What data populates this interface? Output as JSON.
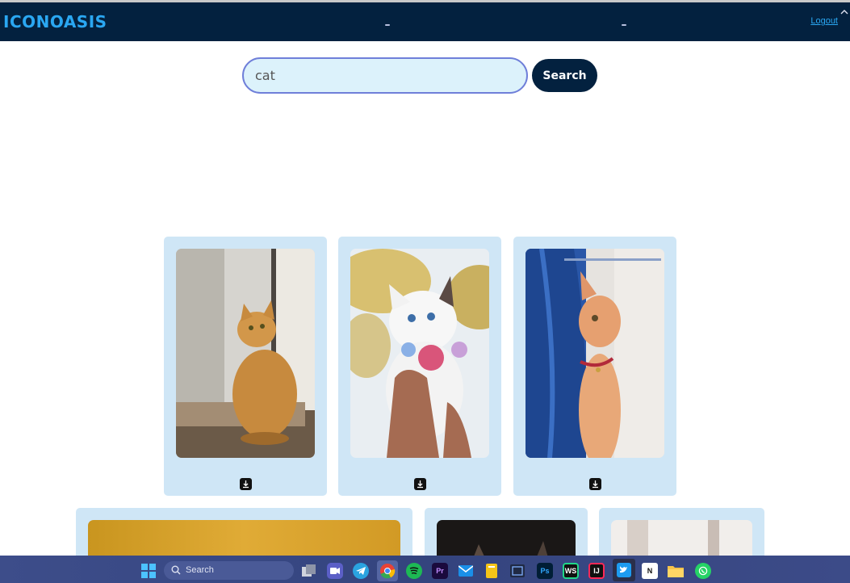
{
  "app": {
    "logo": "ICONOASIS",
    "logout_label": "Logout"
  },
  "search": {
    "value": "cat",
    "button_label": "Search"
  },
  "results": [
    {
      "subject": "orange tabby cat sitting by window"
    },
    {
      "subject": "white fluffy kitten with flower collar held in hands"
    },
    {
      "subject": "orange cat peeking behind blue curtain"
    },
    {
      "subject": "partially visible image, golden background"
    },
    {
      "subject": "partially visible image, dark background with cat ear"
    },
    {
      "subject": "partially visible image, pale background"
    }
  ],
  "taskbar": {
    "search_label": "Search",
    "apps": [
      "start-menu",
      "task-view",
      "teams",
      "telegram",
      "chrome",
      "spotify",
      "premiere-pro",
      "mail",
      "sticky-notes",
      "snipping-tool",
      "photoshop",
      "webstorm",
      "intellij",
      "twitter",
      "notion",
      "file-explorer",
      "whatsapp"
    ],
    "app_labels": {
      "premiere": "Pr",
      "photoshop": "Ps",
      "webstorm": "WS",
      "intellij": "IJ",
      "notion": "N"
    }
  },
  "colors": {
    "header_bg": "#03213f",
    "brand": "#2aa7f2",
    "card_bg": "#cfe6f6",
    "input_bg": "#dcf2fb",
    "input_border": "#6f7fd9"
  }
}
